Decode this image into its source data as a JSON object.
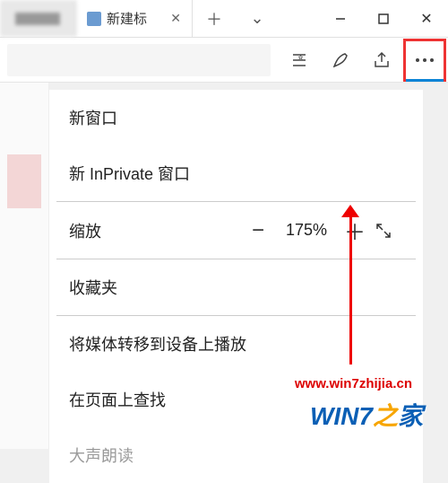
{
  "titlebar": {
    "tab_label": "新建标",
    "new_tab_icon": "plus",
    "chevron_icon": "chevron-down"
  },
  "toolbar": {
    "favorites_icon": "star-list",
    "notes_icon": "pen",
    "share_icon": "share",
    "more_icon": "more"
  },
  "menu": {
    "new_window": "新窗口",
    "new_inprivate": "新 InPrivate 窗口",
    "zoom_label": "缩放",
    "zoom_value": "175%",
    "favorites": "收藏夹",
    "cast": "将媒体转移到设备上播放",
    "find": "在页面上查找",
    "read_aloud": "大声朗读"
  },
  "watermarks": {
    "url": "www.win7zhijia.cn",
    "logo": "WIN7之家"
  }
}
